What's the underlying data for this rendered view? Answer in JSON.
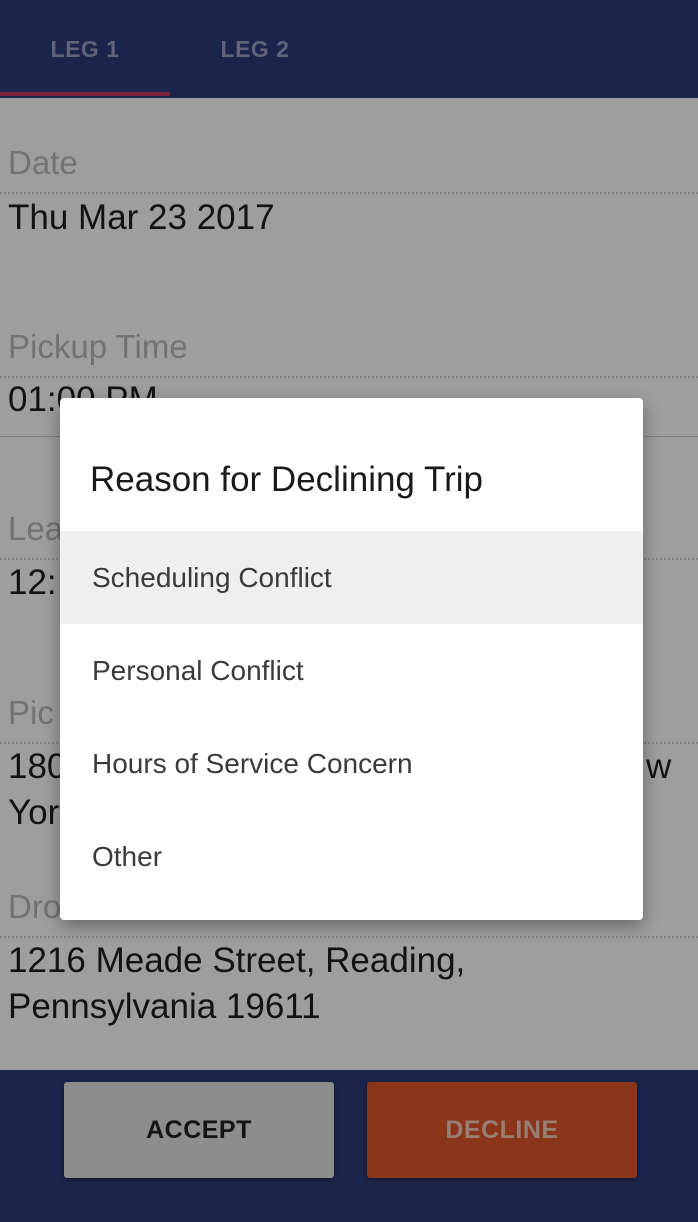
{
  "tabs": [
    {
      "label": "LEG 1",
      "active": true
    },
    {
      "label": "LEG 2",
      "active": false
    }
  ],
  "form": {
    "date": {
      "label": "Date",
      "value": "Thu Mar 23 2017"
    },
    "pickup_time": {
      "label": "Pickup Time",
      "value": "01:00 PM"
    },
    "leave_time": {
      "label": "Lea",
      "value": "12:"
    },
    "pickup_address": {
      "label": "Pic",
      "value_line1": "180",
      "value_line1_end": "w",
      "value_line2": "Yor"
    },
    "dropoff_address": {
      "label": "Dro",
      "value_line1": "1216 Meade Street, Reading,",
      "value_line2": "Pennsylvania 19611"
    }
  },
  "dialog": {
    "title": "Reason for Declining Trip",
    "options": [
      {
        "label": "Scheduling Conflict",
        "selected": true
      },
      {
        "label": "Personal Conflict",
        "selected": false
      },
      {
        "label": "Hours of Service Concern",
        "selected": false
      },
      {
        "label": "Other",
        "selected": false
      }
    ]
  },
  "actions": {
    "accept_label": "ACCEPT",
    "decline_label": "DECLINE"
  },
  "colors": {
    "header_bg": "#2d3a78",
    "tab_indicator": "#c0395b",
    "decline_bg": "#e0562a",
    "accept_bg": "#e4e4e4"
  }
}
